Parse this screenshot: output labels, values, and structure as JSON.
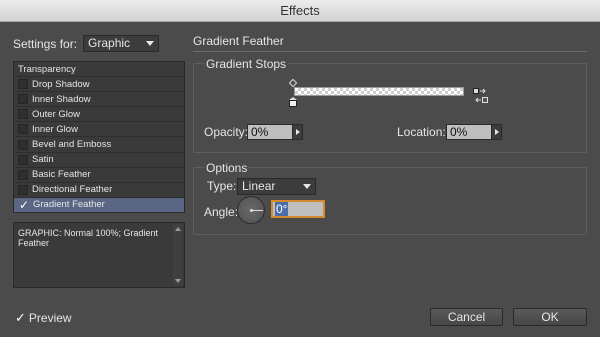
{
  "window": {
    "title": "Effects"
  },
  "settings": {
    "label": "Settings for:",
    "value": "Graphic"
  },
  "effects_list": {
    "header": "Transparency",
    "items": [
      {
        "label": "Drop Shadow",
        "checked": false,
        "selected": false
      },
      {
        "label": "Inner Shadow",
        "checked": false,
        "selected": false
      },
      {
        "label": "Outer Glow",
        "checked": false,
        "selected": false
      },
      {
        "label": "Inner Glow",
        "checked": false,
        "selected": false
      },
      {
        "label": "Bevel and Emboss",
        "checked": false,
        "selected": false
      },
      {
        "label": "Satin",
        "checked": false,
        "selected": false
      },
      {
        "label": "Basic Feather",
        "checked": false,
        "selected": false
      },
      {
        "label": "Directional Feather",
        "checked": false,
        "selected": false
      },
      {
        "label": "Gradient Feather",
        "checked": true,
        "selected": true
      }
    ]
  },
  "summary": {
    "text": "GRAPHIC: Normal 100%; Gradient Feather"
  },
  "preview": {
    "label": "Preview",
    "checked": true
  },
  "panel": {
    "title": "Gradient Feather"
  },
  "gradient_stops": {
    "title": "Gradient Stops",
    "opacity_label": "Opacity:",
    "opacity_value": "0%",
    "location_label": "Location:",
    "location_value": "0%"
  },
  "options": {
    "title": "Options",
    "type_label": "Type:",
    "type_value": "Linear",
    "angle_label": "Angle:",
    "angle_value": "0°"
  },
  "buttons": {
    "cancel": "Cancel",
    "ok": "OK"
  },
  "colors": {
    "selection": "#5a6784",
    "focus_ring": "#d68a2d",
    "background": "#4b4b4b"
  },
  "icons": {
    "reverse": "reverse-gradient-icon",
    "checkmark": "check-icon"
  }
}
